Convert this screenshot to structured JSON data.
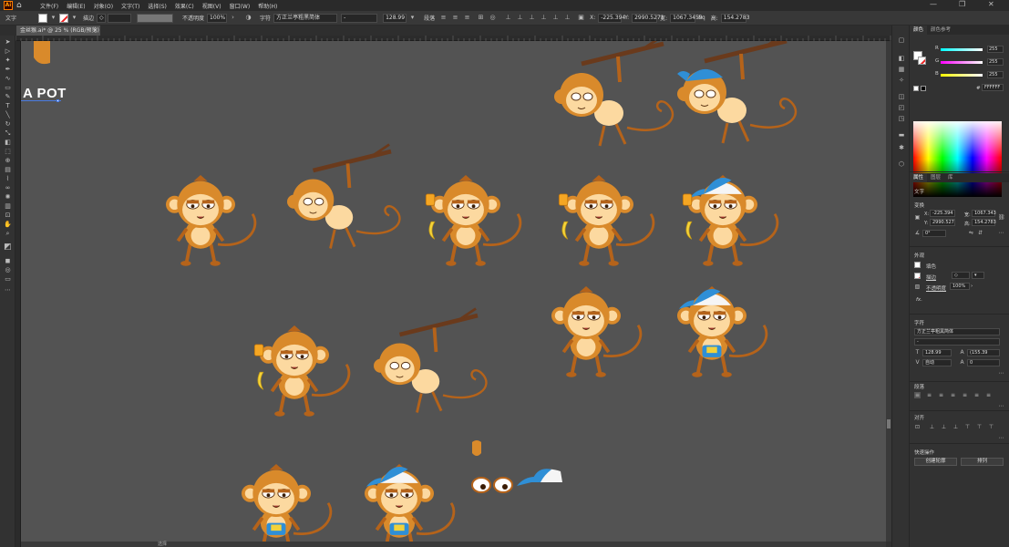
{
  "menubar": {
    "app_logo": "Ai",
    "items": [
      "文件(F)",
      "编辑(E)",
      "对象(O)",
      "文字(T)",
      "选择(S)",
      "效果(C)",
      "视图(V)",
      "窗口(W)",
      "帮助(H)"
    ]
  },
  "controlbar": {
    "mode_label": "文字",
    "stroke_label": "描边",
    "opacity_label": "不透明度",
    "opacity_value": "100%",
    "char_label": "字符",
    "font_value": "方正兰亭粗黑简体",
    "font_style_value": "-",
    "font_size_value": "128.99",
    "para_label": "段落",
    "x_value": "-225.394",
    "y_value": "2990.5271",
    "w_value": "1067.3459",
    "h_value": "154.2783",
    "link_label": "Eq"
  },
  "document": {
    "tab_title": "金丝猴.ai* @ 25 % (RGB/预览)",
    "art_text": "A POT"
  },
  "bottom": {
    "scroll_label": "选择"
  },
  "panel": {
    "top_tabs": [
      "颜色",
      "颜色参考"
    ],
    "color": {
      "r_label": "R",
      "r_value": "255",
      "g_label": "G",
      "g_value": "255",
      "b_label": "B",
      "b_value": "255",
      "hex_label": "#",
      "hex_value": "FFFFFF"
    },
    "props_tabs": [
      "属性",
      "图层",
      "库"
    ],
    "text_section": "文字",
    "transform_section": "变换",
    "x_label": "X:",
    "x_value": "-225.394",
    "y_label": "Y:",
    "y_value": "2990.527",
    "w_label": "宽:",
    "w_value": "1067.343",
    "h_label": "高:",
    "h_value": "154.2783",
    "angle_value": "0°",
    "appearance_section": "外观",
    "fill_label": "填色",
    "stroke_label": "描边",
    "opacity_label": "不透明度",
    "opacity_value": "100%",
    "fx_label": "fx.",
    "char_section": "字符",
    "font_value": "方正兰亭粗黑简体",
    "font_style_value": "-",
    "size_value": "128.99",
    "leading_value": "(155.39",
    "tracking_value": "自动",
    "kerning_value": "0",
    "para_section": "段落",
    "align_section": "对齐",
    "quick_section": "快速操作",
    "outline_button": "创建轮廓",
    "arrange_button": "排列"
  },
  "colors": {
    "fur_dark": "#b5631a",
    "fur_mid": "#d98a2b",
    "face": "#fcd9a0",
    "cap": "#2f8fd6",
    "branch": "#6a3a1c"
  }
}
